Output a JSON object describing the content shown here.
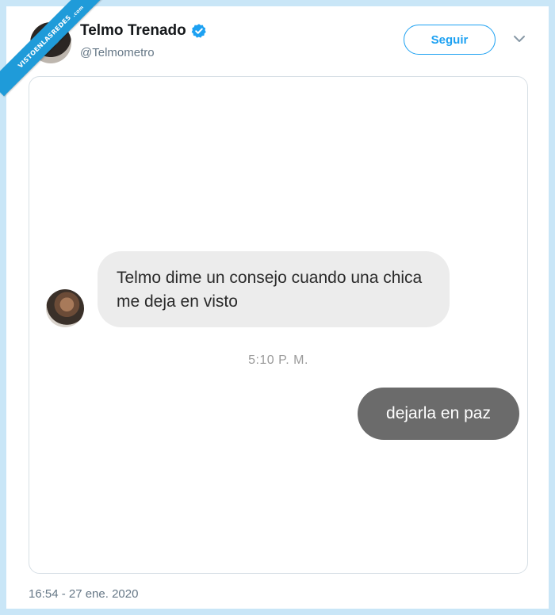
{
  "watermark": {
    "text": "VISTOENLASREDES",
    "suffix": ".com"
  },
  "tweet": {
    "author_name": "Telmo Trenado",
    "handle": "@Telmometro",
    "verified": true,
    "follow_label": "Seguir",
    "date": "16:54 - 27 ene. 2020"
  },
  "chat": {
    "incoming_message": "Telmo dime un consejo cuando una chica me deja en visto",
    "timestamp": "5:10 P. M.",
    "outgoing_message": "dejarla en paz"
  },
  "colors": {
    "accent": "#1da1f2",
    "incoming_bubble": "#ececec",
    "outgoing_bubble": "#6b6b6b",
    "background": "#c9e6f7"
  },
  "icons": [
    "verified-badge-icon",
    "chevron-down-icon"
  ]
}
